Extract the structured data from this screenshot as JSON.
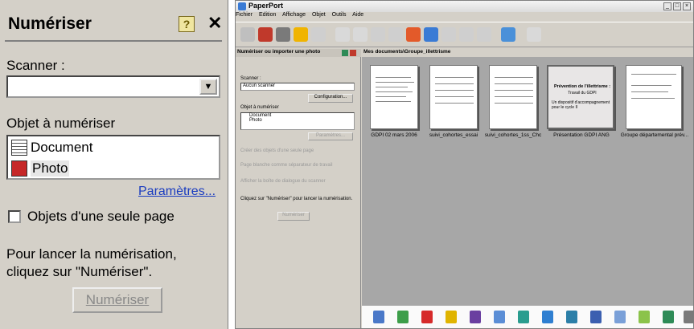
{
  "zoom": {
    "title": "Numériser",
    "help_glyph": "?",
    "close_glyph": "✕",
    "scanner_label": "Scanner :",
    "scanner_value": "",
    "object_label": "Objet à numériser",
    "items": [
      "Document",
      "Photo"
    ],
    "params_link": "Paramètres...",
    "single_page_label": "Objets d'une seule page",
    "instruction": "Pour lancer la numérisation, cliquez sur \"Numériser\".",
    "scan_button": "Numériser"
  },
  "app": {
    "title": "PaperPort",
    "menu": [
      "Fichier",
      "Edition",
      "Affichage",
      "Objet",
      "Outils",
      "Aide"
    ],
    "pane_title": "Numériser ou importer une photo",
    "path": "Mes documents\\Groupe_illettrisme",
    "scanner_label": "Scanner :",
    "scanner_value": "Aucun scanner",
    "config_button": "Configuration...",
    "object_label": "Objet à numériser",
    "items": [
      "Document",
      "Photo"
    ],
    "params_button": "Paramètres...",
    "opt1": "Créer des objets d'une seule page",
    "opt2": "Page blanche comme séparateur de travail",
    "opt3": "Afficher la boîte de dialogue du scanner",
    "instruction": "Cliquez sur \"Numériser\" pour lancer la numérisation.",
    "scan_button": "Numériser",
    "thumbs": [
      {
        "caption": "GDPI 02 mars 2006"
      },
      {
        "caption": "suivi_cohortes_essai"
      },
      {
        "caption": "suivi_cohortes_1ss_Chc"
      },
      {
        "caption": "Présentation GDPI ANG",
        "title": "Prévention de l'illettrisme :",
        "sub": "Travail du GDPI",
        "body": "Un dispositif d'accompagnement pour le cycle II"
      },
      {
        "caption": "Groupe départemental prév..."
      }
    ]
  },
  "colors": {
    "accent": "#0a246a",
    "link": "#1a3cc0",
    "panel": "#d4d0c8"
  }
}
